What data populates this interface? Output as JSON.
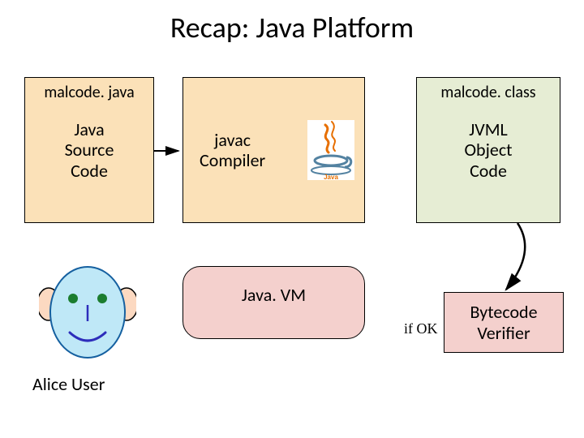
{
  "title": "Recap: Java Platform",
  "boxes": {
    "source": {
      "filename": "malcode. java",
      "label": "Java\nSource\nCode"
    },
    "compiler": {
      "label": "javac\nCompiler"
    },
    "object": {
      "filename": "malcode. class",
      "label": "JVML\nObject\nCode"
    },
    "vm": {
      "label": "Java. VM"
    },
    "verifier": {
      "label": "Bytecode\nVerifier"
    }
  },
  "edge_label": "if OK",
  "user_caption": "Alice User",
  "icons": {
    "java_logo": "java-logo-icon",
    "user_face": "alice-face-icon"
  },
  "colors": {
    "tan": "#fbe1b8",
    "olive": "#e6edd4",
    "salmon": "#f4d0cd"
  }
}
